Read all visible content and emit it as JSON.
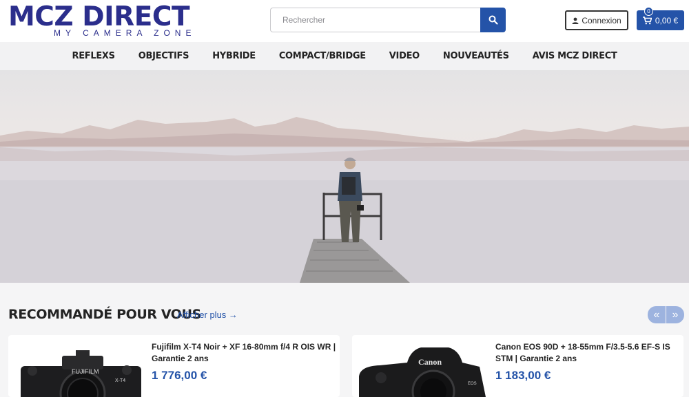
{
  "logo": {
    "main": "MCZ DIRECT",
    "sub": "MY CAMERA ZONE"
  },
  "search": {
    "placeholder": "Rechercher",
    "icon": "search-icon"
  },
  "header": {
    "login_label": "Connexion",
    "cart_total": "0,00 €",
    "cart_count": "0"
  },
  "nav": {
    "items": [
      {
        "label": "REFLEXS"
      },
      {
        "label": "OBJECTIFS"
      },
      {
        "label": "HYBRIDE"
      },
      {
        "label": "COMPACT/BRIDGE"
      },
      {
        "label": "VIDEO"
      },
      {
        "label": "NOUVEAUTÉS"
      },
      {
        "label": "AVIS MCZ DIRECT"
      }
    ]
  },
  "recommended": {
    "title": "RECOMMANDÉ POUR VOUS",
    "more_label": "Afficher plus →",
    "prev_label": "«",
    "next_label": "»",
    "products": [
      {
        "name": "Fujifilm X-T4 Noir + XF 16-80mm f/4 R OIS WR | Garantie 2 ans",
        "price": "1 776,00 €",
        "brand_mark": "FUJIFILM",
        "model_mark": "X-T4"
      },
      {
        "name": "Canon EOS 90D + 18-55mm F/3.5-5.6 EF-S IS STM | Garantie 2 ans",
        "price": "1 183,00 €",
        "brand_mark": "Canon",
        "model_mark": "EOS"
      }
    ]
  },
  "colors": {
    "brand": "#2b2e8c",
    "accent": "#2453a8",
    "nav_bg": "#f2f2f3"
  }
}
